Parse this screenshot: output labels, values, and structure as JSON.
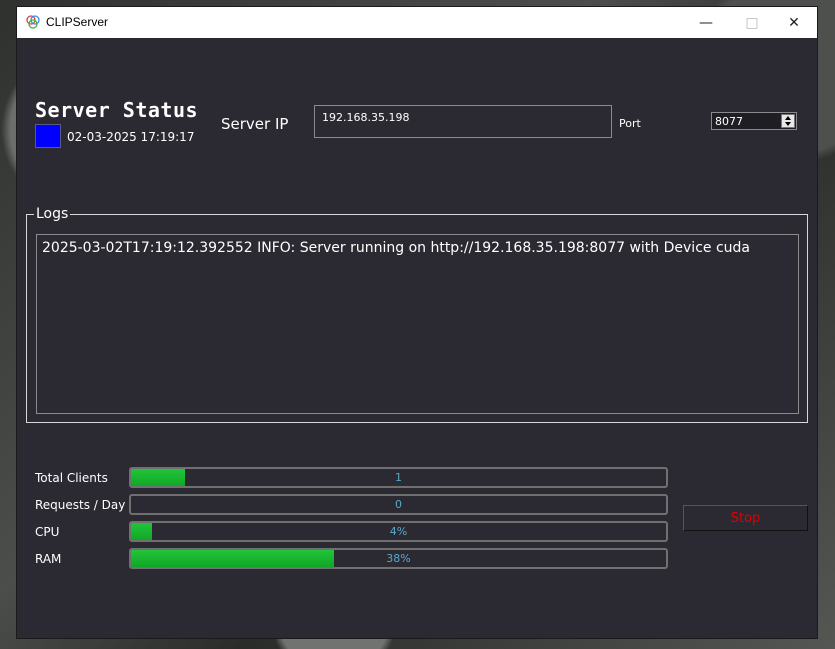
{
  "window": {
    "title": "CLIPServer"
  },
  "header": {
    "title": "Server Status",
    "status_color": "#0000ff",
    "timestamp": "02-03-2025 17:19:17",
    "server_ip_label": "Server IP",
    "server_ip_value": "192.168.35.198",
    "port_label": "Port",
    "port_value": "8077"
  },
  "logs": {
    "legend": "Logs",
    "lines": [
      "2025-03-02T17:19:12.392552  INFO: Server running on http://192.168.35.198:8077 with Device cuda"
    ]
  },
  "stats": [
    {
      "label": "Total Clients",
      "text": "1",
      "fill_percent": 10
    },
    {
      "label": "Requests / Day",
      "text": "0",
      "fill_percent": 0
    },
    {
      "label": "CPU",
      "text": "4%",
      "fill_percent": 4
    },
    {
      "label": "RAM",
      "text": "38%",
      "fill_percent": 38
    }
  ],
  "stop_button": {
    "label": "Stop",
    "color": "#e00000"
  },
  "icons": {
    "app": "clip-app-icon",
    "minimize": "minimize-icon",
    "maximize": "maximize-icon",
    "close": "close-icon"
  }
}
